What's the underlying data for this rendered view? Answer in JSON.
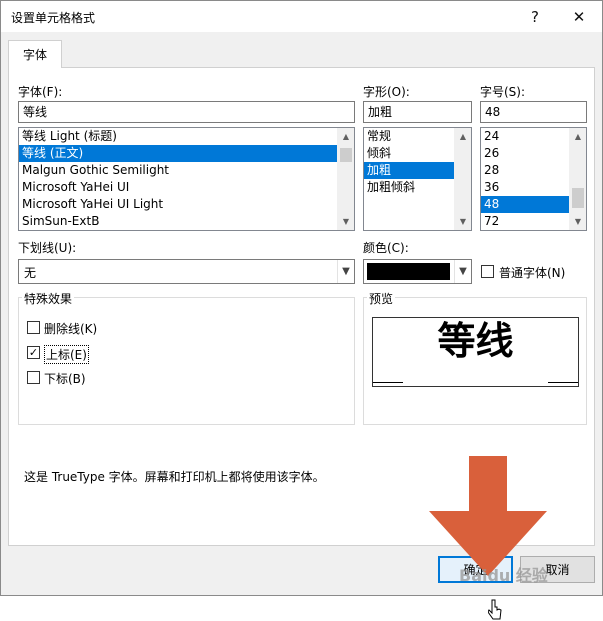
{
  "window": {
    "title": "设置单元格格式",
    "help_glyph": "?",
    "close_glyph": "✕"
  },
  "tabs": [
    "字体"
  ],
  "font": {
    "label": "字体(F):",
    "value": "等线",
    "items": [
      "等线 Light (标题)",
      "等线 (正文)",
      "Malgun Gothic Semilight",
      "Microsoft YaHei UI",
      "Microsoft YaHei UI Light",
      "SimSun-ExtB"
    ],
    "selected_index": 1
  },
  "style": {
    "label": "字形(O):",
    "value": "加粗",
    "items": [
      "常规",
      "倾斜",
      "加粗",
      "加粗倾斜"
    ],
    "selected_index": 2
  },
  "size": {
    "label": "字号(S):",
    "value": "48",
    "items": [
      "24",
      "26",
      "28",
      "36",
      "48",
      "72"
    ],
    "selected_index": 4
  },
  "underline": {
    "label": "下划线(U):",
    "value": "无"
  },
  "color": {
    "label": "颜色(C):",
    "value": "#000000"
  },
  "normal_font": {
    "label": "普通字体(N)",
    "checked": false
  },
  "effects": {
    "legend": "特殊效果",
    "items": [
      {
        "label": "删除线(K)",
        "checked": false
      },
      {
        "label": "上标(E)",
        "checked": true
      },
      {
        "label": "下标(B)",
        "checked": false
      }
    ]
  },
  "preview": {
    "legend": "预览",
    "text": "等线"
  },
  "note": "这是 TrueType 字体。屏幕和打印机上都将使用该字体。",
  "buttons": {
    "ok": "确定",
    "cancel": "取消"
  },
  "overlay": {
    "watermark": "Baidu 经验",
    "arrow_color": "#d9603b"
  }
}
